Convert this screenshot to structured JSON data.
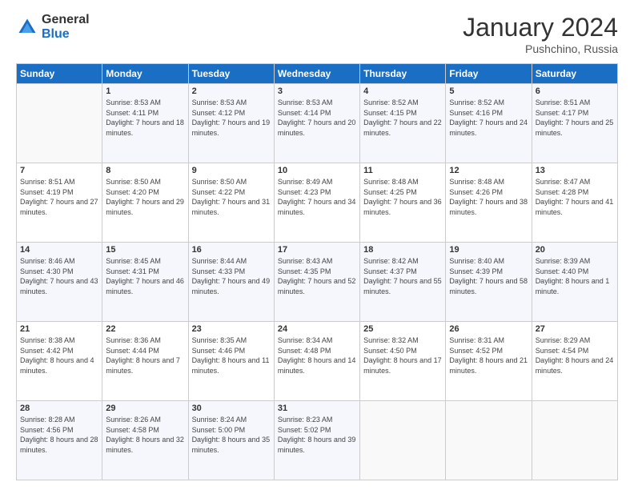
{
  "header": {
    "logo_general": "General",
    "logo_blue": "Blue",
    "month_title": "January 2024",
    "location": "Pushchino, Russia"
  },
  "days_of_week": [
    "Sunday",
    "Monday",
    "Tuesday",
    "Wednesday",
    "Thursday",
    "Friday",
    "Saturday"
  ],
  "weeks": [
    [
      {
        "day": "",
        "sunrise": "",
        "sunset": "",
        "daylight": ""
      },
      {
        "day": "1",
        "sunrise": "Sunrise: 8:53 AM",
        "sunset": "Sunset: 4:11 PM",
        "daylight": "Daylight: 7 hours and 18 minutes."
      },
      {
        "day": "2",
        "sunrise": "Sunrise: 8:53 AM",
        "sunset": "Sunset: 4:12 PM",
        "daylight": "Daylight: 7 hours and 19 minutes."
      },
      {
        "day": "3",
        "sunrise": "Sunrise: 8:53 AM",
        "sunset": "Sunset: 4:14 PM",
        "daylight": "Daylight: 7 hours and 20 minutes."
      },
      {
        "day": "4",
        "sunrise": "Sunrise: 8:52 AM",
        "sunset": "Sunset: 4:15 PM",
        "daylight": "Daylight: 7 hours and 22 minutes."
      },
      {
        "day": "5",
        "sunrise": "Sunrise: 8:52 AM",
        "sunset": "Sunset: 4:16 PM",
        "daylight": "Daylight: 7 hours and 24 minutes."
      },
      {
        "day": "6",
        "sunrise": "Sunrise: 8:51 AM",
        "sunset": "Sunset: 4:17 PM",
        "daylight": "Daylight: 7 hours and 25 minutes."
      }
    ],
    [
      {
        "day": "7",
        "sunrise": "Sunrise: 8:51 AM",
        "sunset": "Sunset: 4:19 PM",
        "daylight": "Daylight: 7 hours and 27 minutes."
      },
      {
        "day": "8",
        "sunrise": "Sunrise: 8:50 AM",
        "sunset": "Sunset: 4:20 PM",
        "daylight": "Daylight: 7 hours and 29 minutes."
      },
      {
        "day": "9",
        "sunrise": "Sunrise: 8:50 AM",
        "sunset": "Sunset: 4:22 PM",
        "daylight": "Daylight: 7 hours and 31 minutes."
      },
      {
        "day": "10",
        "sunrise": "Sunrise: 8:49 AM",
        "sunset": "Sunset: 4:23 PM",
        "daylight": "Daylight: 7 hours and 34 minutes."
      },
      {
        "day": "11",
        "sunrise": "Sunrise: 8:48 AM",
        "sunset": "Sunset: 4:25 PM",
        "daylight": "Daylight: 7 hours and 36 minutes."
      },
      {
        "day": "12",
        "sunrise": "Sunrise: 8:48 AM",
        "sunset": "Sunset: 4:26 PM",
        "daylight": "Daylight: 7 hours and 38 minutes."
      },
      {
        "day": "13",
        "sunrise": "Sunrise: 8:47 AM",
        "sunset": "Sunset: 4:28 PM",
        "daylight": "Daylight: 7 hours and 41 minutes."
      }
    ],
    [
      {
        "day": "14",
        "sunrise": "Sunrise: 8:46 AM",
        "sunset": "Sunset: 4:30 PM",
        "daylight": "Daylight: 7 hours and 43 minutes."
      },
      {
        "day": "15",
        "sunrise": "Sunrise: 8:45 AM",
        "sunset": "Sunset: 4:31 PM",
        "daylight": "Daylight: 7 hours and 46 minutes."
      },
      {
        "day": "16",
        "sunrise": "Sunrise: 8:44 AM",
        "sunset": "Sunset: 4:33 PM",
        "daylight": "Daylight: 7 hours and 49 minutes."
      },
      {
        "day": "17",
        "sunrise": "Sunrise: 8:43 AM",
        "sunset": "Sunset: 4:35 PM",
        "daylight": "Daylight: 7 hours and 52 minutes."
      },
      {
        "day": "18",
        "sunrise": "Sunrise: 8:42 AM",
        "sunset": "Sunset: 4:37 PM",
        "daylight": "Daylight: 7 hours and 55 minutes."
      },
      {
        "day": "19",
        "sunrise": "Sunrise: 8:40 AM",
        "sunset": "Sunset: 4:39 PM",
        "daylight": "Daylight: 7 hours and 58 minutes."
      },
      {
        "day": "20",
        "sunrise": "Sunrise: 8:39 AM",
        "sunset": "Sunset: 4:40 PM",
        "daylight": "Daylight: 8 hours and 1 minute."
      }
    ],
    [
      {
        "day": "21",
        "sunrise": "Sunrise: 8:38 AM",
        "sunset": "Sunset: 4:42 PM",
        "daylight": "Daylight: 8 hours and 4 minutes."
      },
      {
        "day": "22",
        "sunrise": "Sunrise: 8:36 AM",
        "sunset": "Sunset: 4:44 PM",
        "daylight": "Daylight: 8 hours and 7 minutes."
      },
      {
        "day": "23",
        "sunrise": "Sunrise: 8:35 AM",
        "sunset": "Sunset: 4:46 PM",
        "daylight": "Daylight: 8 hours and 11 minutes."
      },
      {
        "day": "24",
        "sunrise": "Sunrise: 8:34 AM",
        "sunset": "Sunset: 4:48 PM",
        "daylight": "Daylight: 8 hours and 14 minutes."
      },
      {
        "day": "25",
        "sunrise": "Sunrise: 8:32 AM",
        "sunset": "Sunset: 4:50 PM",
        "daylight": "Daylight: 8 hours and 17 minutes."
      },
      {
        "day": "26",
        "sunrise": "Sunrise: 8:31 AM",
        "sunset": "Sunset: 4:52 PM",
        "daylight": "Daylight: 8 hours and 21 minutes."
      },
      {
        "day": "27",
        "sunrise": "Sunrise: 8:29 AM",
        "sunset": "Sunset: 4:54 PM",
        "daylight": "Daylight: 8 hours and 24 minutes."
      }
    ],
    [
      {
        "day": "28",
        "sunrise": "Sunrise: 8:28 AM",
        "sunset": "Sunset: 4:56 PM",
        "daylight": "Daylight: 8 hours and 28 minutes."
      },
      {
        "day": "29",
        "sunrise": "Sunrise: 8:26 AM",
        "sunset": "Sunset: 4:58 PM",
        "daylight": "Daylight: 8 hours and 32 minutes."
      },
      {
        "day": "30",
        "sunrise": "Sunrise: 8:24 AM",
        "sunset": "Sunset: 5:00 PM",
        "daylight": "Daylight: 8 hours and 35 minutes."
      },
      {
        "day": "31",
        "sunrise": "Sunrise: 8:23 AM",
        "sunset": "Sunset: 5:02 PM",
        "daylight": "Daylight: 8 hours and 39 minutes."
      },
      {
        "day": "",
        "sunrise": "",
        "sunset": "",
        "daylight": ""
      },
      {
        "day": "",
        "sunrise": "",
        "sunset": "",
        "daylight": ""
      },
      {
        "day": "",
        "sunrise": "",
        "sunset": "",
        "daylight": ""
      }
    ]
  ]
}
